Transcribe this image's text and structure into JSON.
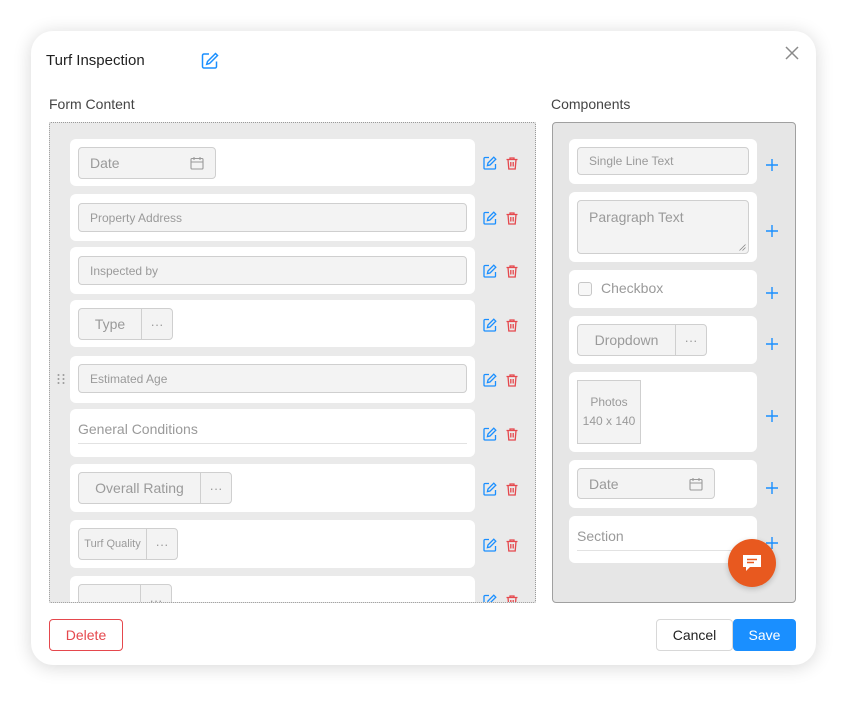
{
  "modal": {
    "title": "Turf Inspection",
    "form_content_label": "Form Content",
    "components_label": "Components"
  },
  "form_fields": [
    {
      "label": "Date",
      "kind": "date"
    },
    {
      "label": "Property Address",
      "kind": "text"
    },
    {
      "label": "Inspected by",
      "kind": "text"
    },
    {
      "label": "Type",
      "kind": "dropdown"
    },
    {
      "label": "Estimated Age",
      "kind": "text"
    },
    {
      "label": "General Conditions",
      "kind": "paragraph"
    },
    {
      "label": "Overall Rating",
      "kind": "dropdown"
    },
    {
      "label": "Turf Quality",
      "kind": "dropdown"
    },
    {
      "label": "",
      "kind": "dropdown"
    }
  ],
  "components": {
    "single_line_text": "Single Line Text",
    "paragraph_text": "Paragraph Text",
    "checkbox": "Checkbox",
    "dropdown": "Dropdown",
    "photos_label": "Photos",
    "photos_size": "140 x 140",
    "date": "Date",
    "section": "Section"
  },
  "dropdown_more": "···",
  "buttons": {
    "delete": "Delete",
    "cancel": "Cancel",
    "save": "Save"
  },
  "colors": {
    "accent": "#1a8fff",
    "danger": "#e5484d",
    "chat": "#e8591f"
  },
  "icons": {
    "edit": "edit-icon",
    "trash": "trash-icon",
    "plus": "plus-icon",
    "close": "close-icon",
    "calendar": "calendar-icon",
    "drag": "drag-handle-icon",
    "chat": "chat-icon"
  }
}
